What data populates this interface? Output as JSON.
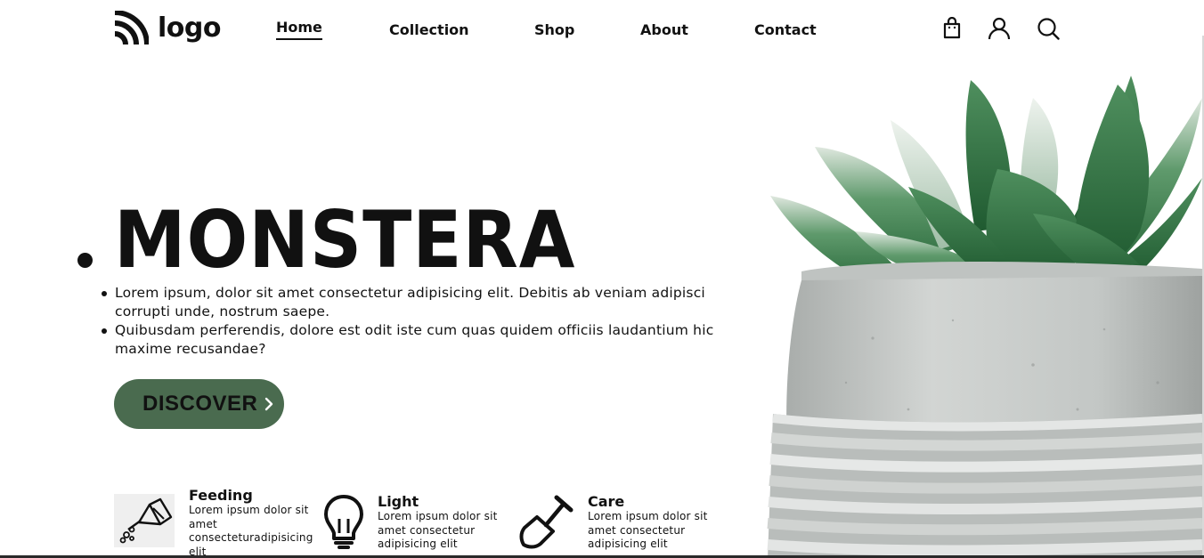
{
  "nav": {
    "logo_text": "logo",
    "links": [
      {
        "label": "Home",
        "active": true
      },
      {
        "label": "Collection",
        "active": false
      },
      {
        "label": "Shop",
        "active": false
      },
      {
        "label": "About",
        "active": false
      },
      {
        "label": "Contact",
        "active": false
      }
    ],
    "icons": [
      "shopping-bag-icon",
      "user-icon",
      "search-icon"
    ]
  },
  "hero": {
    "title": "MONSTERA",
    "bullets": [
      "Lorem ipsum, dolor sit amet consectetur adipisicing elit. Debitis ab veniam adipisci corrupti unde, nostrum saepe.",
      "Quibusdam perferendis, dolore est odit iste cum quas quidem officiis laudantium hic maxime recusandae?"
    ],
    "cta_label": "DISCOVER",
    "cta_color": "#4a6b4f"
  },
  "features": [
    {
      "icon": "watering-can-icon",
      "title": "Feeding",
      "text": "Lorem ipsum dolor sit amet consecteturadipisicing elit"
    },
    {
      "icon": "light-bulb-icon",
      "title": "Light",
      "text": "Lorem ipsum dolor sit amet consectetur adipisicing elit"
    },
    {
      "icon": "shovel-icon",
      "title": "Care",
      "text": "Lorem ipsum dolor sit amet consectetur adipisicing elit"
    }
  ],
  "image": {
    "subject": "succulent-in-concrete-pot"
  }
}
